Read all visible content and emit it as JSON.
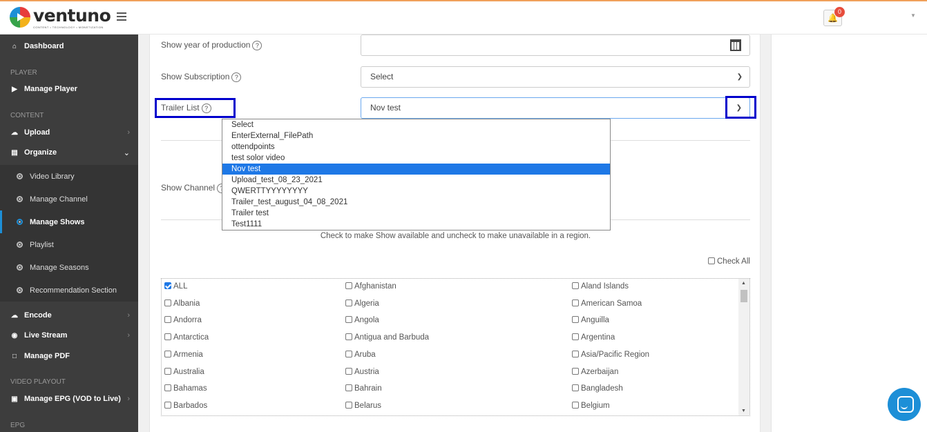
{
  "brand": {
    "name": "ventuno",
    "tagline": "CONTENT  •  TECHNOLOGY  •  MONETIZATION",
    "accent": "#1d8fd7"
  },
  "header": {
    "notifications": "0"
  },
  "sidebar": {
    "dashboard": "Dashboard",
    "player_head": "PLAYER",
    "manage_player": "Manage Player",
    "content_head": "CONTENT",
    "upload": "Upload",
    "organize": "Organize",
    "organize_items": [
      "Video Library",
      "Manage Channel",
      "Manage Shows",
      "Playlist",
      "Manage Seasons",
      "Recommendation Section"
    ],
    "encode": "Encode",
    "live_stream": "Live Stream",
    "manage_pdf": "Manage PDF",
    "playout_head": "VIDEO PLAYOUT",
    "manage_epg": "Manage EPG (VOD to Live)",
    "epg_head": "EPG"
  },
  "form": {
    "year_label": "Show year of production",
    "year_value": "",
    "subscription_label": "Show Subscription",
    "subscription_value": "Select",
    "trailer_label": "Trailer List",
    "trailer_value": "Nov test",
    "trailer_options": [
      "Select",
      "EnterExternal_FilePath",
      "ottendpoints",
      "test solor video",
      "Nov test",
      "Upload_test_08_23_2021",
      "QWERTTYYYYYYYY",
      "Trailer_test_august_04_08_2021",
      "Trailer test",
      "Test1111"
    ],
    "channel_label": "Show Channel",
    "help": "?"
  },
  "regions": {
    "note": "Check to make Show available and uncheck to make unavailable in a region.",
    "check_all": "Check All",
    "col1": [
      "ALL",
      "Albania",
      "Andorra",
      "Antarctica",
      "Armenia",
      "Australia",
      "Bahamas",
      "Barbados"
    ],
    "col2": [
      "Afghanistan",
      "Algeria",
      "Angola",
      "Antigua and Barbuda",
      "Aruba",
      "Austria",
      "Bahrain",
      "Belarus"
    ],
    "col3": [
      "Aland Islands",
      "American Samoa",
      "Anguilla",
      "Argentina",
      "Asia/Pacific Region",
      "Azerbaijan",
      "Bangladesh",
      "Belgium"
    ]
  }
}
